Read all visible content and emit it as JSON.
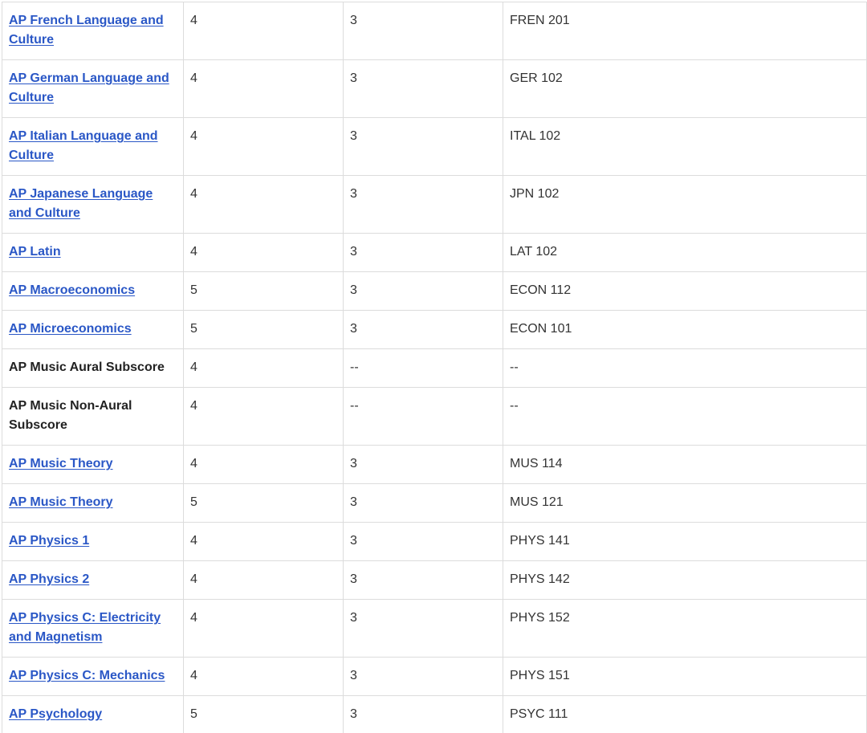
{
  "rows": [
    {
      "course": "AP French Language and Culture",
      "linked": true,
      "score": "4",
      "credits": "3",
      "equivalent": "FREN 201"
    },
    {
      "course": "AP German Language and Culture",
      "linked": true,
      "score": "4",
      "credits": "3",
      "equivalent": "GER 102"
    },
    {
      "course": "AP Italian Language and Culture",
      "linked": true,
      "score": "4",
      "credits": "3",
      "equivalent": "ITAL 102"
    },
    {
      "course": "AP Japanese Language and Culture",
      "linked": true,
      "score": "4",
      "credits": "3",
      "equivalent": "JPN 102"
    },
    {
      "course": "AP Latin",
      "linked": true,
      "score": "4",
      "credits": "3",
      "equivalent": "LAT 102"
    },
    {
      "course": "AP Macroeconomics",
      "linked": true,
      "score": "5",
      "credits": "3",
      "equivalent": "ECON 112"
    },
    {
      "course": "AP Microeconomics",
      "linked": true,
      "score": "5",
      "credits": "3",
      "equivalent": "ECON 101"
    },
    {
      "course": "AP Music Aural Subscore",
      "linked": false,
      "score": "4",
      "credits": "--",
      "equivalent": "--"
    },
    {
      "course": "AP Music Non-Aural Subscore",
      "linked": false,
      "score": "4",
      "credits": "--",
      "equivalent": "--"
    },
    {
      "course": "AP Music Theory",
      "linked": true,
      "score": "4",
      "credits": "3",
      "equivalent": "MUS 114"
    },
    {
      "course": "AP Music Theory",
      "linked": true,
      "score": "5",
      "credits": "3",
      "equivalent": "MUS 121"
    },
    {
      "course": "AP Physics 1",
      "linked": true,
      "score": "4",
      "credits": "3",
      "equivalent": "PHYS 141"
    },
    {
      "course": "AP Physics 2",
      "linked": true,
      "score": "4",
      "credits": "3",
      "equivalent": "PHYS 142"
    },
    {
      "course": "AP Physics C: Electricity and Magnetism",
      "linked": true,
      "score": "4",
      "credits": "3",
      "equivalent": "PHYS 152"
    },
    {
      "course": "AP Physics C: Mechanics",
      "linked": true,
      "score": "4",
      "credits": "3",
      "equivalent": "PHYS 151"
    },
    {
      "course": "AP Psychology",
      "linked": true,
      "score": "5",
      "credits": "3",
      "equivalent": "PSYC 111"
    }
  ]
}
